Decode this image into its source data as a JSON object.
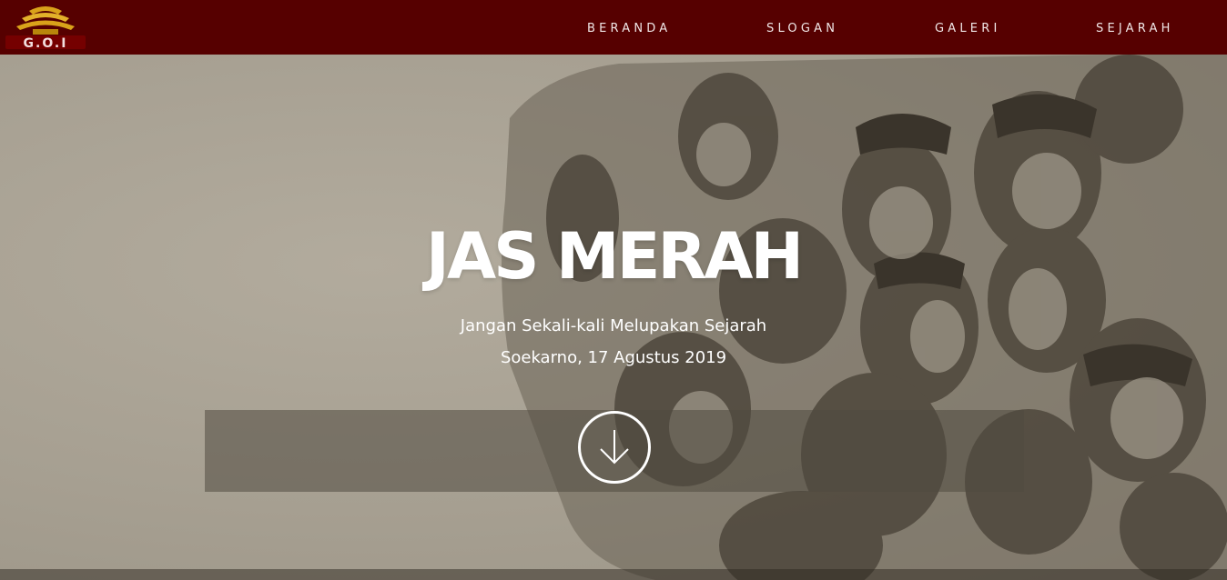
{
  "header": {
    "logo_text": "G.O.I",
    "nav": [
      {
        "label": "BERANDA"
      },
      {
        "label": "SLOGAN"
      },
      {
        "label": "GALERI"
      },
      {
        "label": "SEJARAH"
      }
    ]
  },
  "hero": {
    "title": "JAS MERAH",
    "subtitle": "Jangan Sekali-kali Melupakan Sejarah",
    "attribution": "Soekarno, 17 Agustus 2019",
    "scroll_icon": "arrow-down-circle-icon"
  },
  "colors": {
    "nav_bg": "#560000",
    "hero_bg": "#a69f91",
    "figure_ink": "#4e473c"
  }
}
